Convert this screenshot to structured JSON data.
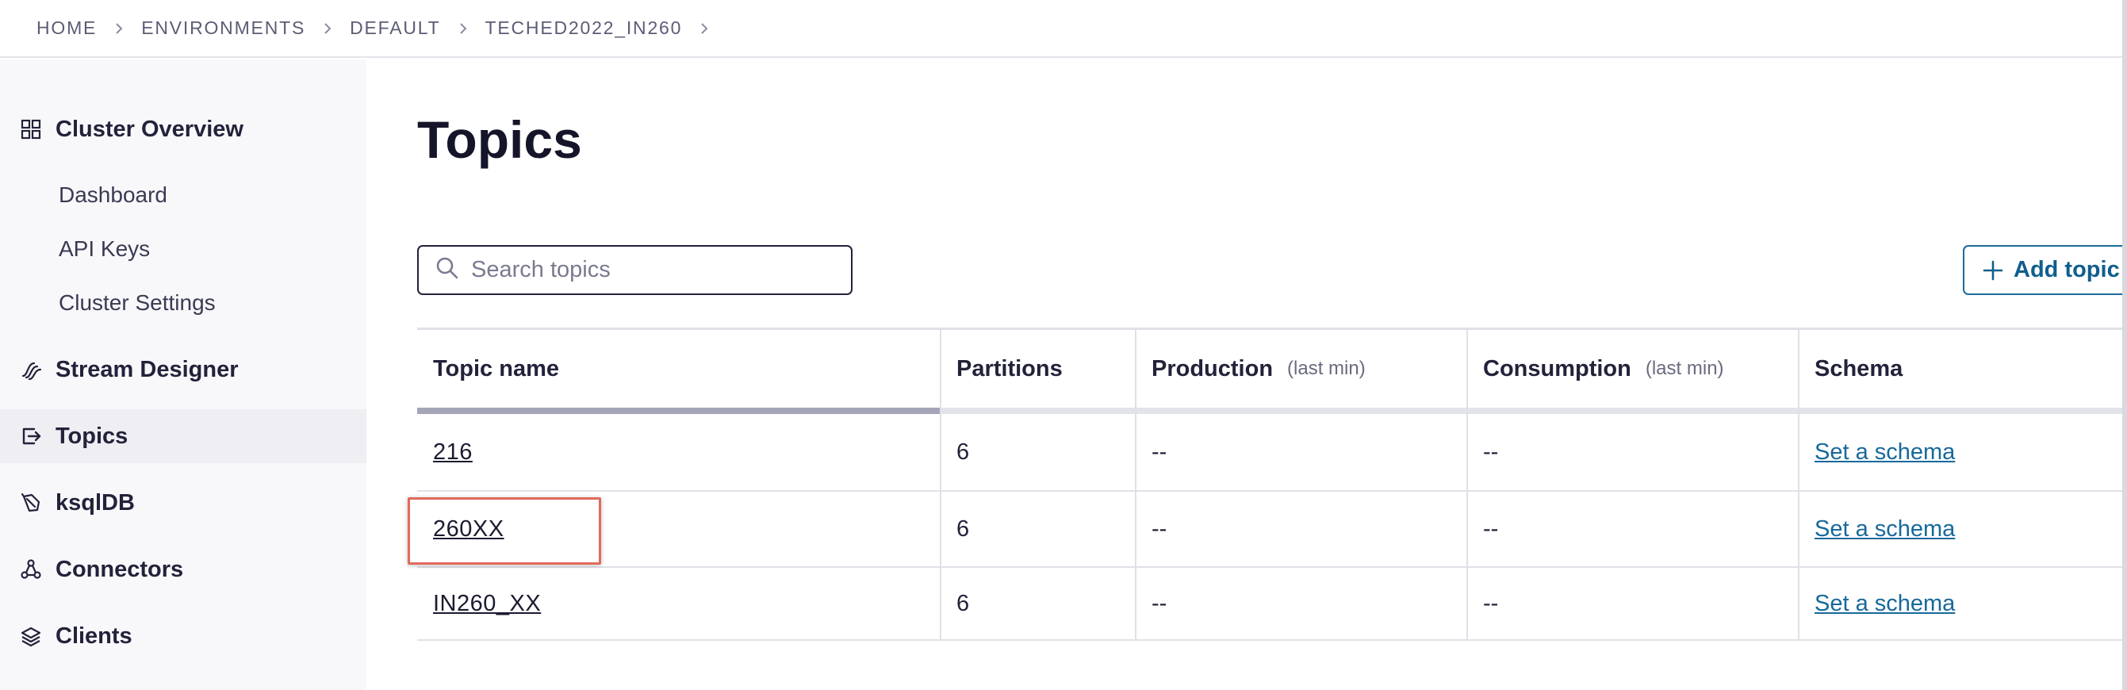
{
  "breadcrumb": [
    "HOME",
    "ENVIRONMENTS",
    "DEFAULT",
    "TECHED2022_IN260"
  ],
  "sidebar": {
    "items": [
      {
        "label": "Cluster Overview",
        "icon": "grid-icon"
      },
      {
        "label": "Stream Designer",
        "icon": "stream-icon"
      },
      {
        "label": "Topics",
        "icon": "topics-icon",
        "active": true
      },
      {
        "label": "ksqlDB",
        "icon": "ksqldb-icon"
      },
      {
        "label": "Connectors",
        "icon": "connectors-icon"
      },
      {
        "label": "Clients",
        "icon": "layers-icon"
      }
    ],
    "sub_items": [
      "Dashboard",
      "API Keys",
      "Cluster Settings"
    ]
  },
  "main": {
    "title": "Topics",
    "search_placeholder": "Search topics",
    "add_button_label": "Add topic"
  },
  "table": {
    "columns": [
      {
        "label": "Topic name",
        "unit": ""
      },
      {
        "label": "Partitions",
        "unit": ""
      },
      {
        "label": "Production",
        "unit": "(last min)"
      },
      {
        "label": "Consumption",
        "unit": "(last min)"
      },
      {
        "label": "Schema",
        "unit": ""
      }
    ],
    "rows": [
      {
        "name": "216",
        "partitions": "6",
        "production": "--",
        "consumption": "--",
        "schema": "Set a schema"
      },
      {
        "name": "260XX",
        "partitions": "6",
        "production": "--",
        "consumption": "--",
        "schema": "Set a schema"
      },
      {
        "name": "IN260_XX",
        "partitions": "6",
        "production": "--",
        "consumption": "--",
        "schema": "Set a schema"
      }
    ]
  },
  "colors": {
    "accent": "#0f5e8d",
    "link": "#17699b",
    "highlight": "#e06a5c",
    "sidebar_bg": "#f8f8fb"
  }
}
